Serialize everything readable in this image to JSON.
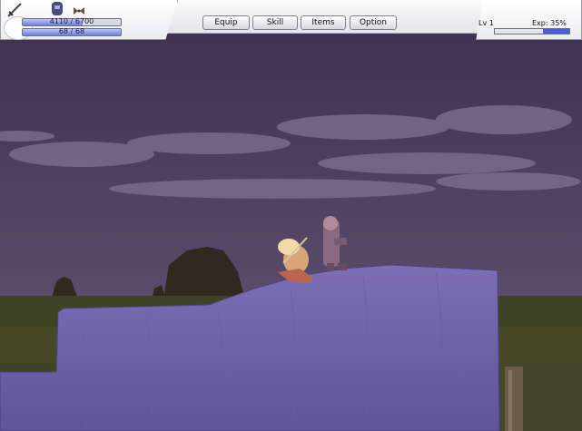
{
  "hud": {
    "hp_text": "4110 / 6700",
    "hp_fraction": 0.6134,
    "mp_text": "68 / 68",
    "mp_fraction": 1.0,
    "icons": [
      "sword-icon",
      "knight-portrait-icon",
      "ribbon-icon"
    ]
  },
  "menu": {
    "equip": "Equip",
    "skill": "Skill",
    "items": "Items",
    "option": "Option"
  },
  "status": {
    "level": "Lv 1",
    "exp": "Exp: 35%",
    "exp_fraction": 0.35
  },
  "colors": {
    "sky": "#4a3d5e",
    "cliff": "#6f61a6",
    "ground": "#3f4326",
    "bar_fill": "#6f7fe0"
  }
}
